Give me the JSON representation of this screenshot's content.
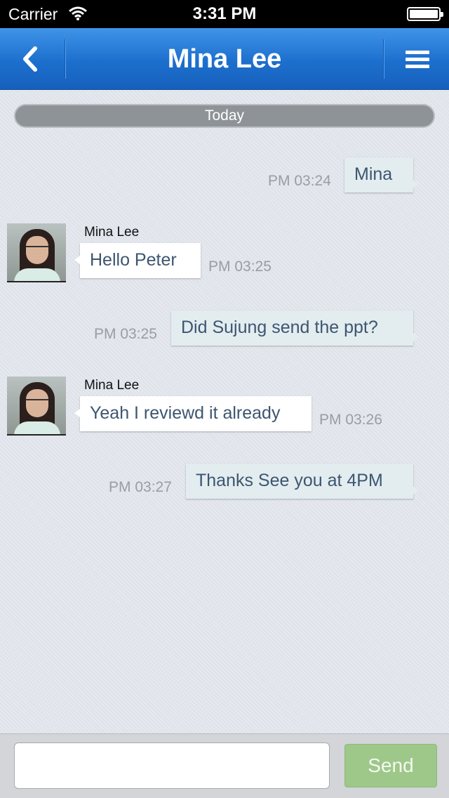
{
  "status_bar": {
    "carrier": "Carrier",
    "time": "3:31 PM"
  },
  "nav": {
    "title": "Mina Lee",
    "back_icon": "chevron-left-icon",
    "menu_icon": "hamburger-menu-icon"
  },
  "chat": {
    "date_separator": "Today",
    "messages": [
      {
        "direction": "out",
        "text": "Mina",
        "time": "PM 03:24"
      },
      {
        "direction": "in",
        "sender": "Mina Lee",
        "text": "Hello Peter",
        "time": "PM 03:25"
      },
      {
        "direction": "out",
        "text": "Did Sujung send the ppt?",
        "time": "PM 03:25"
      },
      {
        "direction": "in",
        "sender": "Mina Lee",
        "text": "Yeah I reviewd it already",
        "time": "PM 03:26"
      },
      {
        "direction": "out",
        "text": "Thanks See you at 4PM",
        "time": "PM 03:27"
      }
    ]
  },
  "composer": {
    "input_value": "",
    "send_label": "Send"
  },
  "colors": {
    "nav_blue": "#1d6fcd",
    "send_green": "#9ec88a",
    "outgoing_bubble": "#e3ecef",
    "incoming_bubble": "#ffffff"
  }
}
